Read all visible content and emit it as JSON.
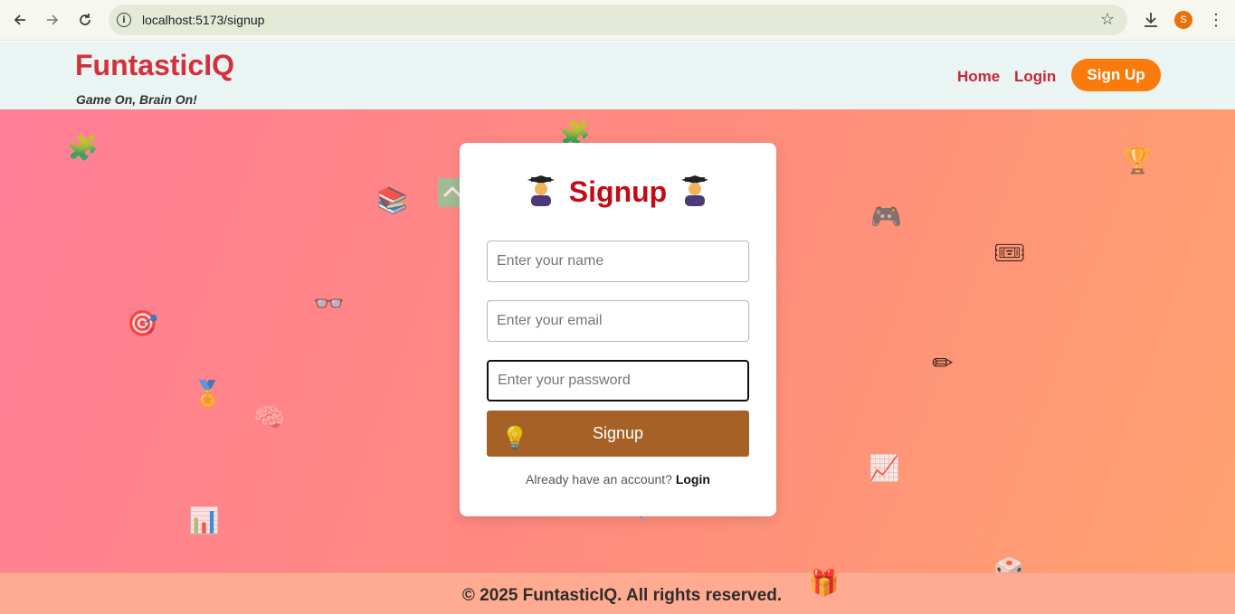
{
  "browser": {
    "url": "localhost:5173/signup",
    "profile_initial": "S"
  },
  "header": {
    "brand": "FuntasticIQ",
    "tagline": "Game On, Brain On!",
    "nav": {
      "home": "Home",
      "login": "Login",
      "signup": "Sign Up"
    }
  },
  "form": {
    "title": "Signup",
    "name_placeholder": "Enter your name",
    "email_placeholder": "Enter your email",
    "password_placeholder": "Enter your password",
    "submit_label": "Signup",
    "switch_prompt": "Already have an account?",
    "switch_link": "Login"
  },
  "footer": {
    "text": "© 2025 FuntasticIQ. All rights reserved."
  },
  "decorations": [
    "puzzle-icon",
    "puzzle-icon",
    "books-icon",
    "chevron-up-icon",
    "trophy-icon",
    "game-controller-icon",
    "ticket-icon",
    "party-popper-icon",
    "target-icon",
    "glasses-icon",
    "pencil-icon",
    "medal-icon",
    "brain-icon",
    "chart-icon",
    "bar-chart-icon",
    "balloon-icon",
    "dice-icon",
    "gift-icon",
    "lightbulb-icon"
  ],
  "colors": {
    "brand": "#d32f3c",
    "signup_button": "#fb7a0c",
    "submit_button": "#a66226",
    "title": "#c30b16"
  }
}
